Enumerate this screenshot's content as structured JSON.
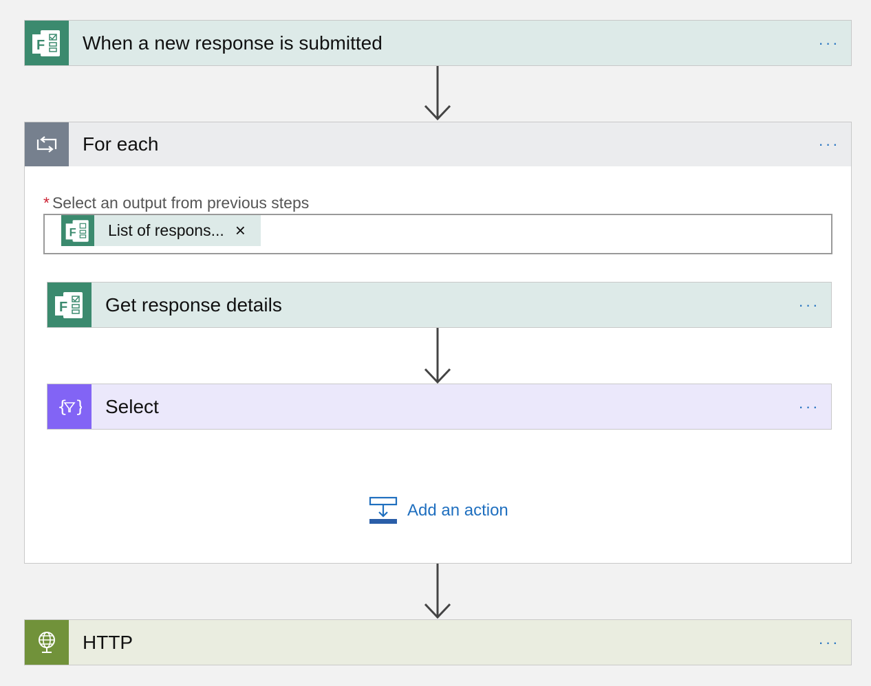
{
  "trigger": {
    "title": "When a new response is submitted",
    "icon": "forms-icon",
    "more": "···"
  },
  "foreach": {
    "title": "For each",
    "icon": "loop-icon",
    "more": "···",
    "field_required_mark": "*",
    "field_label": "Select an output from previous steps",
    "token_label": "List of respons...",
    "token_close": "×",
    "token_icon": "forms-icon"
  },
  "get_response": {
    "title": "Get response details",
    "icon": "forms-icon",
    "more": "···"
  },
  "select": {
    "title": "Select",
    "icon": "data-operation-icon",
    "more": "···"
  },
  "add_action": {
    "label": "Add an action",
    "icon": "add-action-icon"
  },
  "http": {
    "title": "HTTP",
    "icon": "globe-icon",
    "more": "···"
  },
  "colors": {
    "forms": "#3b8a6e",
    "loop": "#76808e",
    "select": "#8264f5",
    "http": "#71923a",
    "link": "#1f6fbf"
  }
}
